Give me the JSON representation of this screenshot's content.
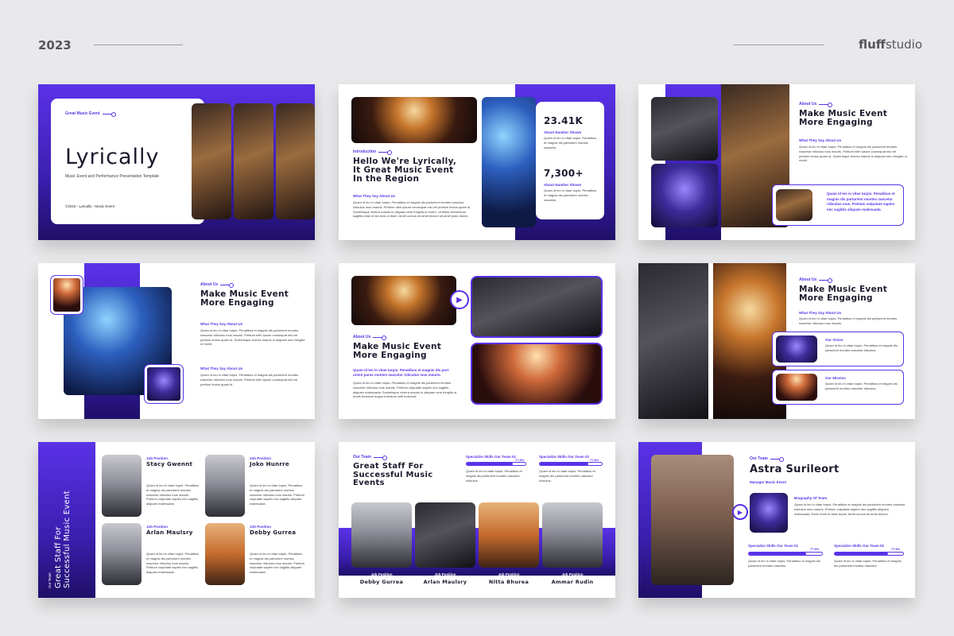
{
  "header": {
    "year": "2023",
    "brand_bold": "fluff",
    "brand_rest": "studio"
  },
  "s1": {
    "tag": "Great Music Event",
    "title": "Lyrically",
    "subtitle": "Music Event and Performance Presentation Template",
    "footer": "©2023 - Lyrically - Music Event"
  },
  "s2": {
    "tag": "Introduction",
    "title_l1": "Hello We're Lyrically,",
    "title_l2": "It Great Music Event",
    "title_l3": "In the Region",
    "sub": "What They Say About Us",
    "para": "Quam id leo in vitae turpis. Penatibus et magnis dis parturient montes nascetur ridiculus mus mauris. Pretium nibh ipsum consequat nisl vel pretium lectus quam id. Scelerisque viverra mauris in aliquam sem fringilla ut morbi. Ut tellus elementum sagittis vitae et leo duis ut diam. Amet cursus sit amet dictum sit amet justo donec.",
    "stat1": "23.41K",
    "stat1_label": "About Number Shown",
    "stat2": "7,300+",
    "stat2_label": "About Number Shown",
    "stat_para": "Quam id leo in vitae turpis. Penatibus et magnis dis parturient montes nascetur."
  },
  "s3": {
    "tag": "About Us",
    "title_l1": "Make Music Event",
    "title_l2": "More Engaging",
    "sub": "What They Say About Us",
    "para": "Quam id leo in vitae turpis. Penatibus et magnis dis parturient montes nascetur ridiculus mus mauris. Pretium nibh ipsum consequat nisl vel pretium lectus quam id. Scelerisque viverra mauris in aliquam sem fringilla ut morbi.",
    "card_text": "Quam id leo in vitae turpis. Penatibus et magnis dis parturient montes nascetur ridiculus mus. Pretium vulputate sapien nec sagittis aliquam malesuada."
  },
  "s4": {
    "tag": "About Us",
    "title_l1": "Make Music Event",
    "title_l2": "More Engaging",
    "sub1": "What They Say About Us",
    "para1": "Quam id leo in vitae turpis. Penatibus et magnis dis parturient montes nascetur ridiculus mus mauris. Pretium nibh ipsum consequat nisl vel pretium lectus quam id. Scelerisque viverra mauris in aliquam sem fringilla ut morbi.",
    "sub2": "What They Say About Us",
    "para2": "Quam id leo in vitae turpis. Penatibus et magnis dis parturient montes nascetur ridiculus mus mauris. Pretium nibh ipsum consequat nisl vel pretium lectus quam id."
  },
  "s5": {
    "tag": "About Us",
    "title_l1": "Make Music Event",
    "title_l2": "More Engaging",
    "lead": "Quam id leo in vitae turpis. Penatibus et magnis dis port urient paras montes nascetur ridiculus mus mauris.",
    "para": "Quam id leo in vitae turpis. Penatibus et magnis dis parturient montes nascetur ridiculus mus mauris. Pretium vulputate sapien nec sagittis aliquam malesuada. Scelerisque viverra mauris in aliquam sem fringilla ut morbi tincidunt augue interdum velit euismod."
  },
  "s6": {
    "tag": "About Us",
    "title_l1": "Make Music Event",
    "title_l2": "More Engaging",
    "sub": "What They Say About Us",
    "para": "Quam id leo in vitae turpis. Penatibus et magnis dis parturient montes nascetur ridiculus mus mauris.",
    "vision_title": "Our Vision",
    "vision_text": "Quam id leo in vitae turpis. Penatibus et magnis dis parturient montes nascetur ridiculus.",
    "mission_title": "Our Mission",
    "mission_text": "Quam id leo in vitae turpis. Penatibus et magnis dis parturient montes nascetur ridiculus."
  },
  "s7": {
    "side_title_l1": "Great Staff For",
    "side_title_l2": "Successful Music Event",
    "side_tag": "Our Team",
    "members": [
      {
        "position": "Job Position",
        "name": "Stacy Gwennt",
        "text": "Quam id leo in vitae turpis. Penatibus et magnis dis parturient montes nascetur ridiculus mus mauris. Pretium vulputate sapien nec sagittis aliquam malesuada."
      },
      {
        "position": "Job Position",
        "name": "Joko Hunrre",
        "text": "Quam id leo in vitae turpis. Penatibus et magnis dis parturient montes nascetur ridiculus mus mauris. Pretium vulputate sapien nec sagittis aliquam malesuada."
      },
      {
        "position": "Job Position",
        "name": "Arlan Maulsry",
        "text": "Quam id leo in vitae turpis. Penatibus et magnis dis parturient montes nascetur ridiculus mus mauris. Pretium vulputate sapien nec sagittis aliquam malesuada."
      },
      {
        "position": "Job Position",
        "name": "Debby Gurrea",
        "text": "Quam id leo in vitae turpis. Penatibus et magnis dis parturient montes nascetur ridiculus mus mauris. Pretium vulputate sapien nec sagittis aliquam malesuada."
      }
    ]
  },
  "s8": {
    "tag": "Our Team",
    "title_l1": "Great Staff For",
    "title_l2": "Successful Music",
    "title_l3": "Events",
    "skill1_label": "Specialize Skills Our Team 01",
    "skill1_value": "77.8%",
    "skill1_fraction": 0.778,
    "skill1_text": "Quam id leo in vitae turpis. Penatibus et magnis dis parturient montes nascetur ridiculus.",
    "skill2_label": "Specialize Skills Our Team 02",
    "skill2_value": "77.8%",
    "skill2_fraction": 0.778,
    "skill2_text": "Quam id leo in vitae turpis. Penatibus et magnis dis parturient montes nascetur ridiculus.",
    "team": [
      {
        "position": "Job Position",
        "name": "Debby Gurrea"
      },
      {
        "position": "Job Position",
        "name": "Arlan Maulsry"
      },
      {
        "position": "Job Position",
        "name": "Nitta Bhurea"
      },
      {
        "position": "Job Position",
        "name": "Ammar Rudin"
      }
    ]
  },
  "s9": {
    "tag": "Our Team",
    "name": "Astra Surileort",
    "role": "Manager Music Event",
    "bio_title": "Biography Of Team",
    "bio_text": "Quam id leo in vitae turpis. Penatibus et magnis dis parturient montes nascetur ridiculus mus mauris. Pretium vulputate sapien nec sagittis aliquam malesuada. Ester enim in vitae turpis. Amet cursus sit amet dictum.",
    "skill1_label": "Specialize Skills Our Team 01",
    "skill1_value": "77.8%",
    "skill1_fraction": 0.778,
    "skill1_text": "Quam id leo in vitae turpis. Penatibus et magnis dis parturient montes nascetur.",
    "skill2_label": "Specialize Skills Our Team 02",
    "skill2_value": "77.8%",
    "skill2_fraction": 0.778,
    "skill2_text": "Quam id leo in vitae turpis. Penatibus et magnis dis parturient montes nascetur."
  },
  "colors": {
    "accent": "#5a32e8",
    "deep": "#1f0f68",
    "background": "#e9e9eb"
  }
}
